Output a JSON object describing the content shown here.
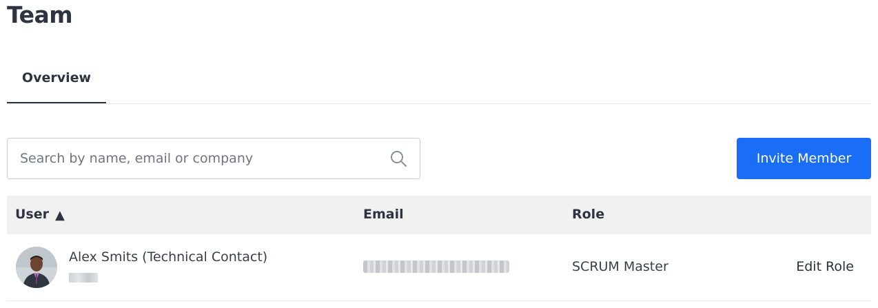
{
  "page": {
    "title": "Team"
  },
  "tabs": [
    {
      "label": "Overview",
      "active": true
    }
  ],
  "search": {
    "placeholder": "Search by name, email or company",
    "value": "",
    "icon": "search-icon"
  },
  "actions": {
    "invite_label": "Invite Member",
    "accent": "#1a6ef5"
  },
  "table": {
    "columns": [
      {
        "label": "User",
        "sort": "ascending",
        "sort_glyph": "▲"
      },
      {
        "label": "Email"
      },
      {
        "label": "Role"
      }
    ],
    "rows": [
      {
        "name": "Alex Smits (Technical Contact)",
        "role": "SCRUM Master",
        "action_label": "Edit Role",
        "avatar": "user-photo"
      }
    ]
  }
}
